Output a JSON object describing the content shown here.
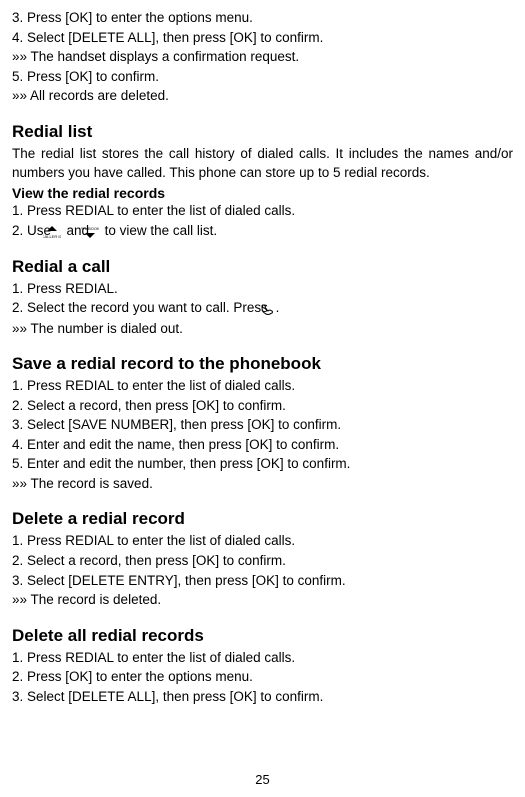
{
  "intro_lines": [
    "3. Press [OK] to enter the options menu.",
    "4. Select [DELETE ALL], then press [OK] to confirm.",
    "»» The handset displays a confirmation request.",
    "5. Press [OK] to confirm.",
    "»» All records are deleted."
  ],
  "sections": {
    "redial_list": {
      "title": "Redial list",
      "body": "The redial list stores the call history of dialed calls. It includes the names and/or numbers you have called. This phone can store up to 5 redial records.",
      "sub_title": "View the redial records",
      "items": [
        "1. Press REDIAL to enter the list of dialed calls.",
        "2. Use {UP_ICON} and {DOWN_ICON} to view the call list."
      ]
    },
    "redial_call": {
      "title": "Redial a call",
      "items": [
        "1. Press REDIAL.",
        "2. Select the record you want to call. Press {PHONE_ICON}.",
        "»» The number is dialed out."
      ]
    },
    "save_redial": {
      "title": "Save a redial record to the phonebook",
      "items": [
        "1. Press REDIAL to enter the list of dialed calls.",
        "2. Select a record, then press [OK] to confirm.",
        "3. Select [SAVE NUMBER], then press [OK] to confirm.",
        "4. Enter and edit the name, then press [OK] to confirm.",
        "5. Enter and edit the number, then press [OK] to confirm.",
        "»» The record is saved."
      ]
    },
    "delete_redial": {
      "title": "Delete a redial record",
      "items": [
        "1. Press REDIAL to enter the list of dialed calls.",
        "2. Select a record, then press [OK] to confirm.",
        "3. Select [DELETE ENTRY], then press [OK] to confirm.",
        "»» The record is deleted."
      ]
    },
    "delete_all_redial": {
      "title": "Delete all redial records",
      "items": [
        "1. Press REDIAL to enter the list of dialed calls.",
        "2. Press [OK] to enter the options menu.",
        "3. Select [DELETE ALL], then press [OK] to confirm."
      ]
    }
  },
  "page_number": "25",
  "icons": {
    "up": "up-arrow-caller-id-icon",
    "down": "down-arrow-phbook-icon",
    "phone": "phone-handset-icon"
  }
}
